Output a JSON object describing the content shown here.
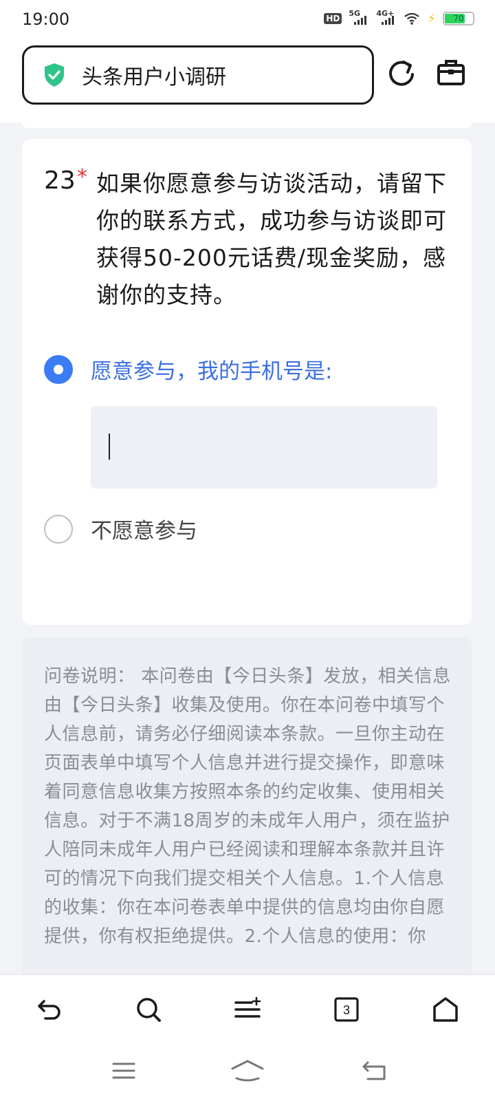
{
  "status_bar": {
    "time": "19:00",
    "hd": "HD",
    "net1": "5G",
    "net2": "4G+",
    "battery": "70"
  },
  "browser": {
    "title": "头条用户小调研",
    "icons": [
      "shield-check-icon",
      "refresh-icon",
      "toolbox-icon"
    ]
  },
  "question": {
    "number": "23",
    "required_mark": "*",
    "text": "如果你愿意参与访谈活动，请留下你的联系方式，成功参与访谈即可获得50-200元话费/现金奖励，感谢你的支持。",
    "options": [
      {
        "label": "愿意参与，我的手机号是:",
        "selected": true
      },
      {
        "label": "不愿意参与",
        "selected": false
      }
    ],
    "phone_value": ""
  },
  "notice": {
    "text": "问卷说明： 本问卷由【今日头条】发放，相关信息由【今日头条】收集及使用。你在本问卷中填写个人信息前，请务必仔细阅读本条款。一旦你主动在页面表单中填写个人信息并进行提交操作，即意味着同意信息收集方按照本条的约定收集、使用相关信息。对于不满18周岁的未成年人用户，须在监护人陪同未成年人用户已经阅读和理解本条款并且许可的情况下向我们提交相关个人信息。1.个人信息的收集：你在本问卷表单中提供的信息均由你自愿提供，你有权拒绝提供。2.个人信息的使用：你"
  },
  "bottom_nav": {
    "tab_count": "3",
    "icons": [
      "back-icon",
      "search-icon",
      "menu-icon",
      "tabs-icon",
      "home-icon"
    ]
  },
  "colors": {
    "accent": "#3b7cf5",
    "required": "#e5323a",
    "shield": "#2fc48a"
  }
}
